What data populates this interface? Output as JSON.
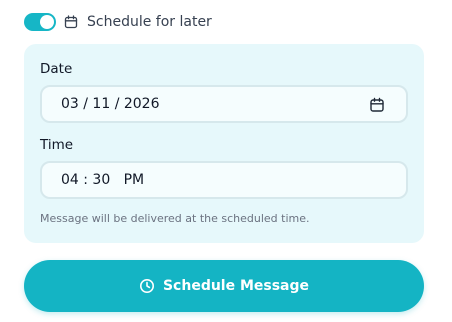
{
  "toggle": {
    "label": "Schedule for later",
    "on": true
  },
  "date_field": {
    "label": "Date",
    "value": "03 / 11 / 2026"
  },
  "time_field": {
    "label": "Time",
    "value": "04 : 30   PM"
  },
  "hint": "Message will be delivered at the scheduled time.",
  "submit_button": {
    "label": "Schedule Message"
  },
  "colors": {
    "accent": "#14b4c4",
    "panel_bg": "#e6f8fb"
  },
  "icons": {
    "toggle_row": "calendar-icon",
    "date_field": "calendar-icon",
    "submit_button": "clock-icon"
  }
}
